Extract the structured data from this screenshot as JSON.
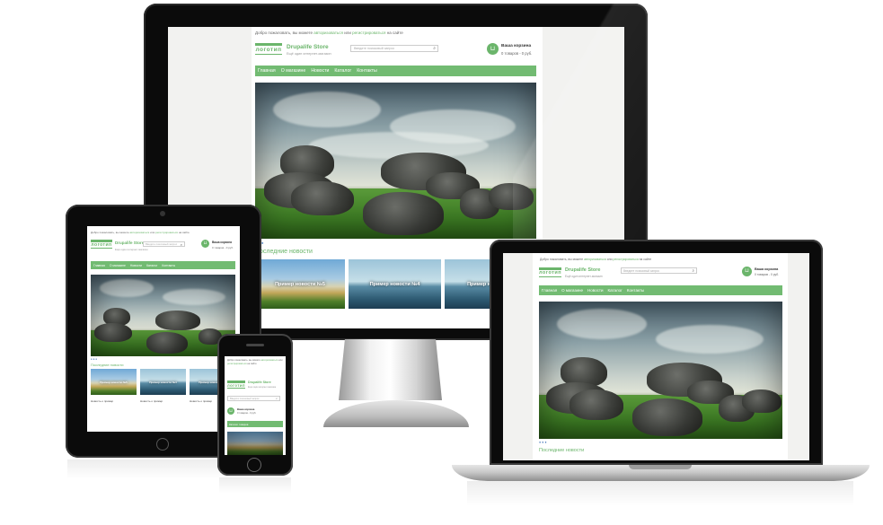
{
  "site": {
    "welcome_prefix": "Добро пожаловать, вы можете",
    "login_link": "авторизоваться",
    "welcome_or": "или",
    "register_link": "регистрироваться",
    "welcome_suffix": "на сайте",
    "logo_text": "логотип",
    "store_name": "Drupalife Store",
    "slogan": "Ещё один интернет-магазин",
    "search_placeholder": "Введите поисковый запрос",
    "cart_title": "Ваша корзина",
    "cart_info": "0 товаров - 0 руб.",
    "menu": [
      "Главная",
      "О магазине",
      "Новости",
      "Каталог",
      "Контакты"
    ],
    "news_heading": "Последние новости",
    "news_items": [
      "Пример новости №5",
      "Пример новости №4",
      "Пример новости №3"
    ],
    "tablet_news": [
      "Новость о пример",
      "Новость о пример",
      "Новость о пример"
    ],
    "catalog_button": "Каталог товаров",
    "slider_dots": "● ● ●"
  },
  "colors": {
    "accent": "#6bb56b",
    "menu": "#72bb72",
    "device": "#0b0b0b"
  },
  "icons": {
    "search": "search-icon",
    "cart": "cart-icon",
    "home_button": "home-button-icon"
  }
}
